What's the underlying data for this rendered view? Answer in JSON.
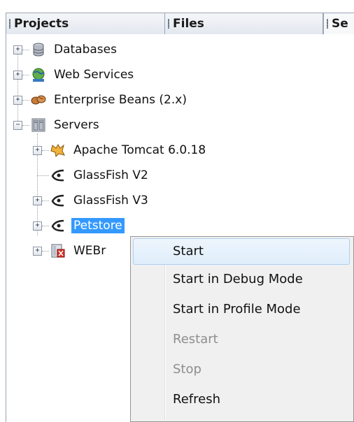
{
  "tabs": {
    "projects": "Projects",
    "files": "Files",
    "services": "Se"
  },
  "tree": {
    "databases": "Databases",
    "web_services": "Web Services",
    "enterprise_beans": "Enterprise Beans (2.x)",
    "servers": "Servers",
    "apache_tomcat": "Apache Tomcat 6.0.18",
    "glassfish_v2": "GlassFish V2",
    "glassfish_v3": "GlassFish V3",
    "petstore": "Petstore",
    "webr": "WEBr"
  },
  "context_menu": {
    "start": "Start",
    "start_debug": "Start in Debug Mode",
    "start_profile": "Start in Profile Mode",
    "restart": "Restart",
    "stop": "Stop",
    "refresh": "Refresh"
  },
  "colors": {
    "selection": "#3399ff",
    "menu_background": "#f0f0f0",
    "disabled_text": "#8e8e8e"
  },
  "icons": {
    "databases": "database-icon",
    "web_services": "web-services-icon",
    "enterprise_beans": "beans-icon",
    "servers": "servers-icon",
    "apache_tomcat": "tomcat-icon",
    "glassfish": "glassfish-icon",
    "webr": "weblogic-server-icon"
  }
}
